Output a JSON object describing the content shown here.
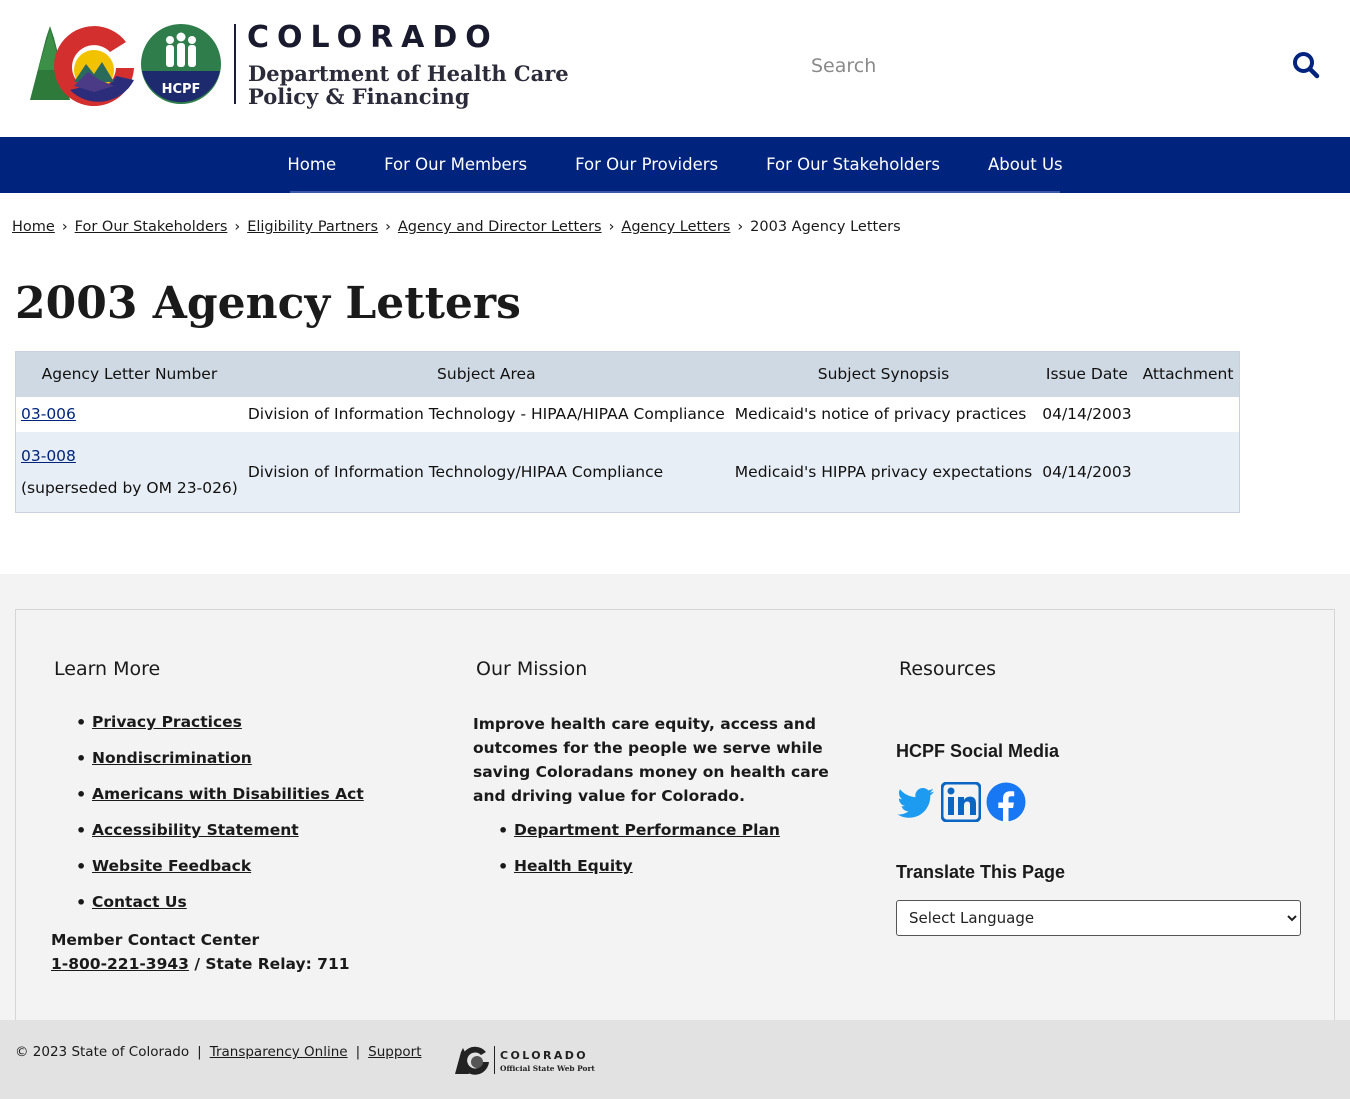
{
  "header": {
    "logo_title": "COLORADO",
    "logo_subtitle_line1": "Department of Health Care",
    "logo_subtitle_line2": "Policy & Financing",
    "hcpf_badge": "HCPF",
    "search_placeholder": "Search"
  },
  "nav": {
    "items": [
      {
        "label": "Home"
      },
      {
        "label": "For Our Members"
      },
      {
        "label": "For Our Providers"
      },
      {
        "label": "For Our Stakeholders"
      },
      {
        "label": "About Us"
      }
    ]
  },
  "breadcrumb": {
    "items": [
      "Home",
      "For Our Stakeholders",
      "Eligibility Partners",
      "Agency and Director Letters",
      "Agency Letters"
    ],
    "current": "2003 Agency Letters",
    "separator": "›"
  },
  "page": {
    "title": "2003 Agency Letters"
  },
  "table": {
    "headers": [
      "Agency Letter Number",
      "Subject Area",
      "Subject Synopsis",
      "Issue Date",
      "Attachment"
    ],
    "rows": [
      {
        "number": "03-006",
        "note": "",
        "subject_area": "Division of Information Technology - HIPAA/HIPAA Compliance",
        "synopsis": "Medicaid's notice of privacy practices",
        "issue_date": "04/14/2003",
        "attachment": ""
      },
      {
        "number": "03-008",
        "note": "(superseded by OM 23-026)",
        "subject_area": "Division of Information Technology/HIPAA Compliance",
        "synopsis": "Medicaid's HIPPA privacy expectations",
        "issue_date": "04/14/2003",
        "attachment": ""
      }
    ]
  },
  "footer": {
    "learn_more": {
      "heading": "Learn More",
      "links": [
        "Privacy Practices",
        "Nondiscrimination",
        "Americans with Disabilities Act",
        "Accessibility Statement",
        "Website Feedback",
        "Contact Us"
      ],
      "contact_label": "Member Contact Center",
      "phone": "1-800-221-3943",
      "relay": " / State Relay: 711"
    },
    "mission": {
      "heading": "Our Mission",
      "text": "Improve health care equity, access and outcomes for the people we serve while saving Coloradans money on health care and driving value for Colorado.",
      "links": [
        "Department Performance Plan",
        "Health Equity"
      ]
    },
    "resources": {
      "heading": "Resources",
      "social_heading": "HCPF Social Media",
      "social_icons": [
        "twitter-icon",
        "linkedin-icon",
        "facebook-icon"
      ],
      "translate_heading": "Translate This Page",
      "language_select": "Select Language"
    }
  },
  "bottom_bar": {
    "copyright": "© 2023 State of Colorado",
    "links": [
      "Transparency Online",
      "Support"
    ],
    "portal_title": "COLORADO",
    "portal_subtitle": "Official State Web Portal"
  },
  "colors": {
    "nav_bg": "#00247d",
    "table_header_bg": "#cfd9e4",
    "table_alt_row_bg": "#e7eef6",
    "footer_bg": "#f3f3f3",
    "twitter": "#1d9bf0",
    "linkedin": "#0a66c2",
    "facebook": "#1877f2"
  }
}
